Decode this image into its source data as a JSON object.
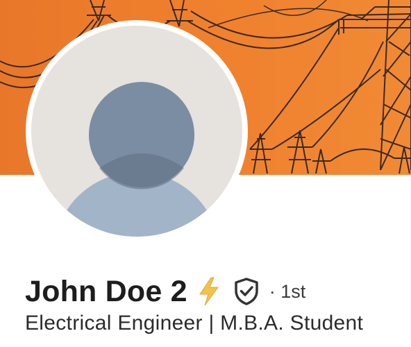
{
  "profile": {
    "name": "John Doe 2",
    "degree": "· 1st",
    "headline": "Electrical Engineer | M.B.A. Student"
  },
  "banner": {
    "description_icon": "power-lines-illustration",
    "colors": {
      "sky": "#ef7e2c",
      "towers": "#3a2a22"
    }
  },
  "badges": {
    "bolt_icon": "lightning-bolt-icon",
    "verified_icon": "verified-shield-icon"
  },
  "colors": {
    "avatar_bg": "#e6e2de",
    "avatar_head": "#7b8da3",
    "avatar_body": "#a2b4c8",
    "bolt": "#f2c24a"
  }
}
